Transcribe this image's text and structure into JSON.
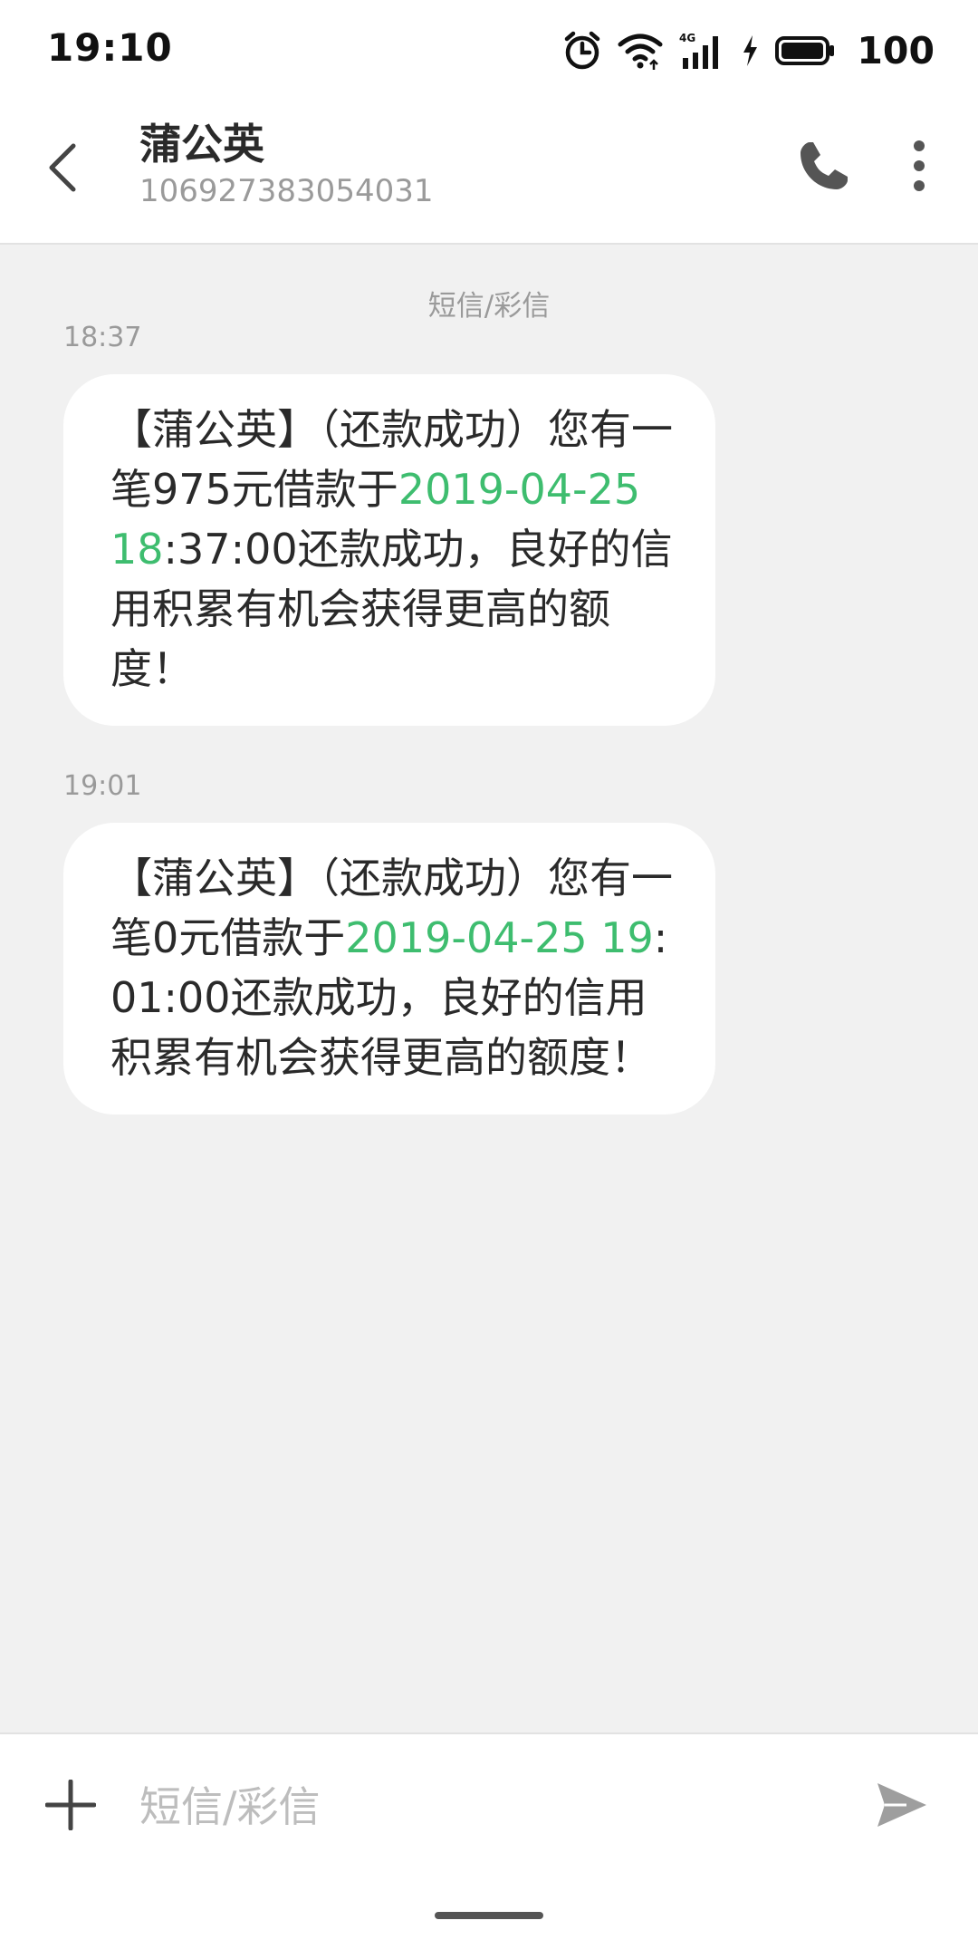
{
  "status_bar": {
    "time": "19:10",
    "network": "4G",
    "battery": "100",
    "icons": [
      "alarm-icon",
      "wifi-icon",
      "signal-4g-icon",
      "charging-icon",
      "battery-icon"
    ]
  },
  "header": {
    "contact_name": "蒲公英",
    "contact_number": "106927383054031",
    "icons": [
      "back-arrow-icon",
      "phone-icon",
      "more-vertical-icon"
    ]
  },
  "conversation": {
    "channel_label": "短信/彩信",
    "messages": [
      {
        "time": "18:37",
        "text_before": "【蒲公英】（还款成功）您有一笔975元借款于",
        "link": "2019-04-25 18",
        "text_after": ":37:00还款成功，良好的信用积累有机会获得更高的额度！"
      },
      {
        "time": "19:01",
        "text_before": "【蒲公英】（还款成功）您有一笔0元借款于",
        "link": "2019-04-25 19",
        "text_after": ":01:00还款成功，良好的信用积累有机会获得更高的额度！"
      }
    ]
  },
  "compose": {
    "placeholder": "短信/彩信",
    "icons": [
      "plus-icon",
      "send-icon"
    ]
  },
  "colors": {
    "background": "#f1f1f1",
    "bubble": "#ffffff",
    "link": "#3ebd6f",
    "muted_text": "#9a9a9a"
  }
}
